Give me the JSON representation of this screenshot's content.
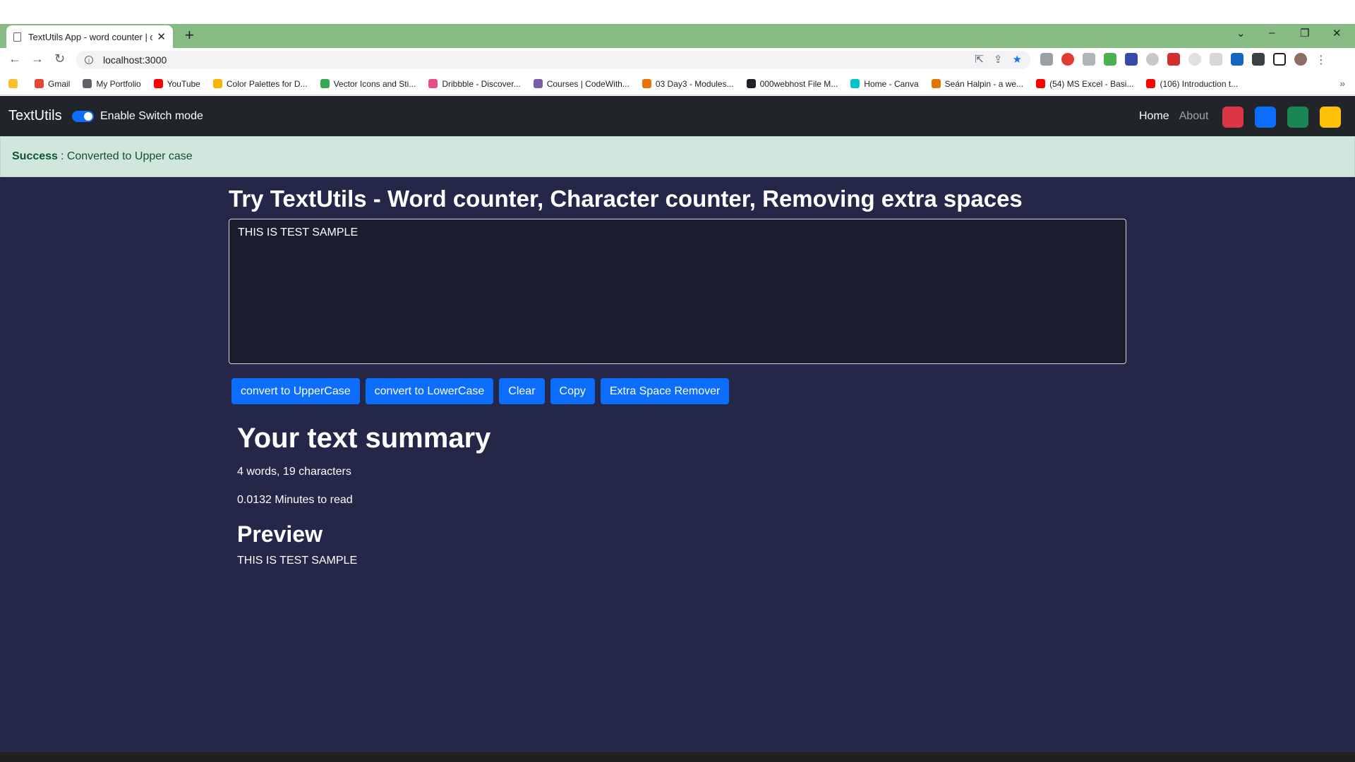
{
  "browser": {
    "tab_title": "TextUtils App - word counter | ch",
    "url": "localhost:3000",
    "bookmarks": [
      {
        "label": "Gmail",
        "color": "#ea4335"
      },
      {
        "label": "My Portfolio",
        "color": "#5f6368"
      },
      {
        "label": "YouTube",
        "color": "#ff0000"
      },
      {
        "label": "Color Palettes for D...",
        "color": "#f4b400"
      },
      {
        "label": "Vector Icons and Sti...",
        "color": "#34a853"
      },
      {
        "label": "Dribbble - Discover...",
        "color": "#ea4c89"
      },
      {
        "label": "Courses | CodeWith...",
        "color": "#7b5ea7"
      },
      {
        "label": "03 Day3 - Modules...",
        "color": "#e8710a"
      },
      {
        "label": "000webhost File M...",
        "color": "#202124"
      },
      {
        "label": "Home - Canva",
        "color": "#00c4cc"
      },
      {
        "label": "Seán Halpin - a we...",
        "color": "#e37400"
      },
      {
        "label": "(54) MS Excel - Basi...",
        "color": "#ff0000"
      },
      {
        "label": "(106) Introduction t...",
        "color": "#ff0000"
      }
    ]
  },
  "app": {
    "brand": "TextUtils",
    "switch_label": "Enable Switch mode",
    "nav": {
      "home": "Home",
      "about": "About"
    },
    "swatches": [
      "#dc3545",
      "#0d6efd",
      "#198754",
      "#ffc107"
    ],
    "alert": {
      "type": "Success",
      "message": ": Converted to Upper case"
    },
    "heading": "Try TextUtils - Word counter, Character counter, Removing extra spaces",
    "textarea_value": "THIS IS TEST SAMPLE",
    "buttons": {
      "upper": "convert to UpperCase",
      "lower": "convert to LowerCase",
      "clear": "Clear",
      "copy": "Copy",
      "extra": "Extra Space Remover"
    },
    "summary": {
      "title": "Your text summary",
      "counts": "4 words, 19 characters",
      "read_time": "0.0132 Minutes to read",
      "preview_title": "Preview",
      "preview_text": "THIS IS TEST SAMPLE"
    }
  }
}
